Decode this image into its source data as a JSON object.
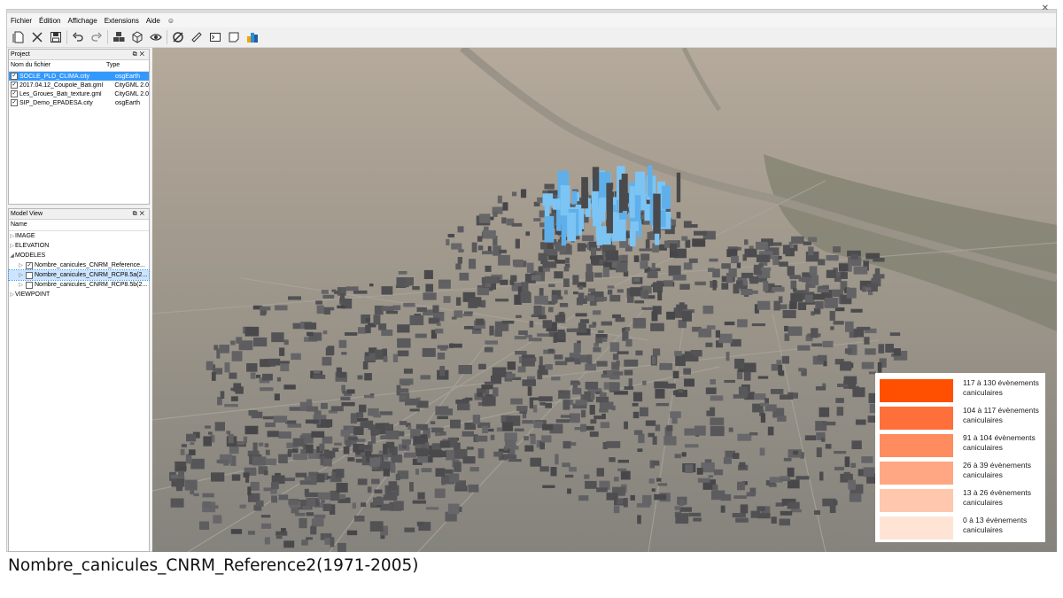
{
  "menu": {
    "items": [
      "Fichier",
      "Édition",
      "Affichage",
      "Extensions",
      "Aide"
    ],
    "smiley": "☺"
  },
  "toolbar": {
    "icons": [
      "new-file-icon",
      "close-icon",
      "save-icon",
      "undo-icon",
      "redo-icon",
      "cubes-icon",
      "cube-icon",
      "eye-icon",
      "satellite-icon",
      "ruler-icon",
      "console-icon",
      "note-icon",
      "chart-icon"
    ]
  },
  "project": {
    "title": "Project",
    "col_name": "Nom du fichier",
    "col_type": "Type",
    "files": [
      {
        "name": "SOCLE_PLD_CLIMA.city",
        "type": "osgEarth",
        "checked": true,
        "selected": true
      },
      {
        "name": "2017.04.12_Coupole_Bati.gml",
        "type": "CityGML 2.0",
        "checked": true,
        "selected": false
      },
      {
        "name": "Les_Groues_Bati_texture.gml",
        "type": "CityGML 2.0",
        "checked": true,
        "selected": false
      },
      {
        "name": "SIP_Demo_EPADESA.city",
        "type": "osgEarth",
        "checked": true,
        "selected": false
      }
    ]
  },
  "model_view": {
    "title": "Model View",
    "col_name": "Name",
    "image": "IMAGE",
    "elevation": "ELEVATION",
    "modeles": "MODELES",
    "models": [
      {
        "name": "Nombre_canicules_CNRM_Reference...",
        "checked": true,
        "selected": false
      },
      {
        "name": "Nombre_canicules_CNRM_RCP8.5a(2...",
        "checked": false,
        "selected": true
      },
      {
        "name": "Nombre_canicules_CNRM_RCP8.5b(2...",
        "checked": false,
        "selected": false
      }
    ],
    "viewpoint": "VIEWPOINT"
  },
  "legend": {
    "items": [
      {
        "label": "117 à 130 évènements caniculaires",
        "color": "#ff4f00"
      },
      {
        "label": "104 à 117 évènements caniculaires",
        "color": "#ff6f3a"
      },
      {
        "label": "91 à 104 évènements caniculaires",
        "color": "#ff8c5e"
      },
      {
        "label": "26 à 39 évènements caniculaires",
        "color": "#ffa783"
      },
      {
        "label": "13 à 26 évènements caniculaires",
        "color": "#ffc7ad"
      },
      {
        "label": "0 à 13 évènements caniculaires",
        "color": "#ffe4d6"
      }
    ]
  },
  "caption": "Nombre_canicules_CNRM_Reference2(1971-2005)",
  "colors": {
    "selection": "#3399ff",
    "highlight_buildings": "#7cc4f4",
    "buildings": "#5e5e60"
  }
}
